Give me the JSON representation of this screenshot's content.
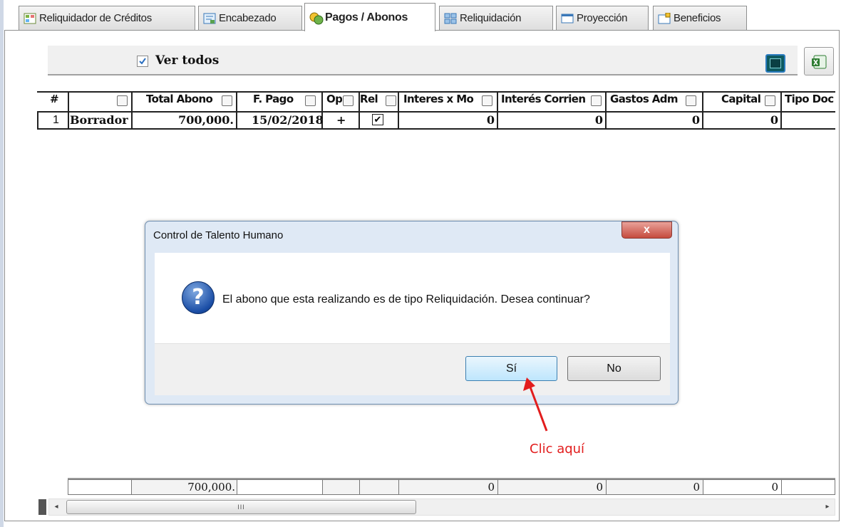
{
  "tabs": [
    {
      "label": "Reliquidador de Créditos",
      "icon": "grid-icon"
    },
    {
      "label": "Encabezado",
      "icon": "form-icon"
    },
    {
      "label": "Pagos / Abonos",
      "icon": "payments-icon"
    },
    {
      "label": "Reliquidación",
      "icon": "recalc-icon"
    },
    {
      "label": "Proyección",
      "icon": "window-icon"
    },
    {
      "label": "Beneficios",
      "icon": "benefits-icon"
    }
  ],
  "active_tab": "Pagos / Abonos",
  "toolbar": {
    "ver_todos_label": "Ver todos",
    "ver_todos_checked": true
  },
  "grid": {
    "headers": [
      "#",
      "",
      "Total Abono",
      "F. Pago",
      "Op",
      "Rel",
      "Interes x Mo",
      "Interés Corrien",
      "Gastos Adm",
      "Capital",
      "Tipo Doc"
    ],
    "row": {
      "num": "1",
      "estado": "Borrador",
      "total": "700,000.",
      "fecha": "15/02/2018",
      "op": "+",
      "rel": "✔",
      "interes_mora": "0",
      "interes_corriente": "0",
      "gastos": "0",
      "capital": "0"
    },
    "totals": {
      "total": "700,000.",
      "interes_mora": "0",
      "interes_corriente": "0",
      "gastos": "0",
      "capital": "0"
    },
    "scroll_grip": "III"
  },
  "dialog": {
    "title": "Control de Talento Humano",
    "close": "x",
    "icon": "question-icon",
    "message": "El abono que esta realizando es de tipo Reliquidación. Desea continuar?",
    "yes_label": "Sí",
    "no_label": "No"
  },
  "annotation": {
    "text": "Clic aquí",
    "color": "#e21d1d"
  }
}
